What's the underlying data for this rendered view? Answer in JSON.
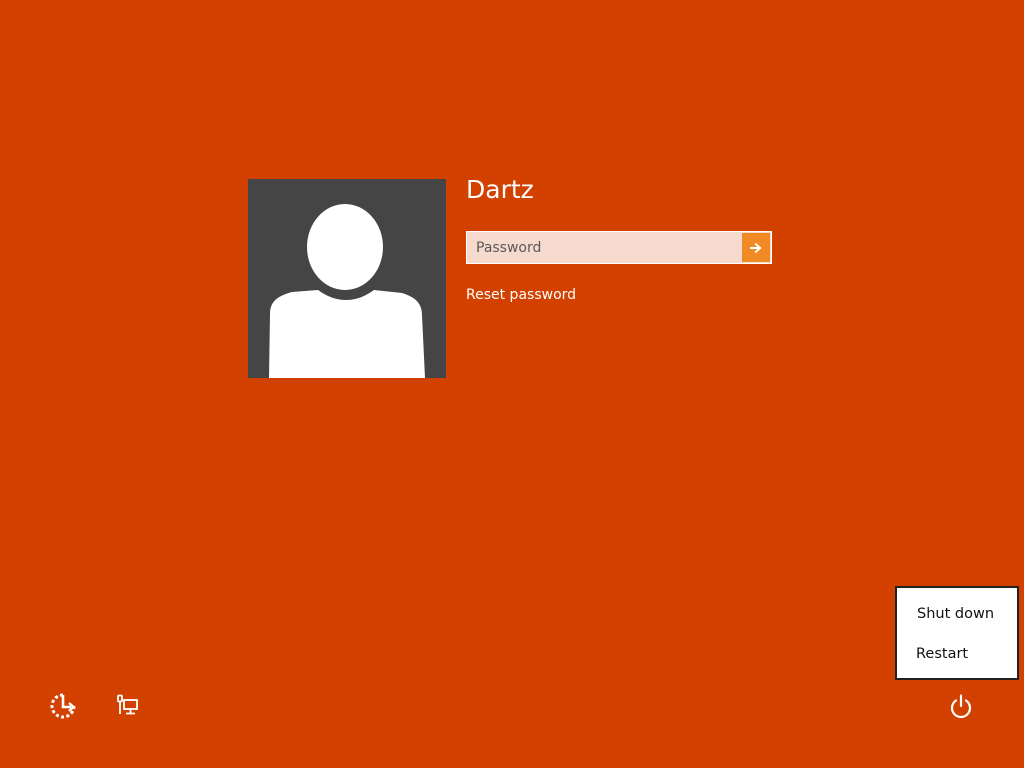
{
  "colors": {
    "background": "#D24100",
    "avatar_bg": "#454545",
    "password_field_bg": "#F6DACE",
    "submit_button": "#F08A24",
    "menu_bg": "#FFFFFF"
  },
  "user": {
    "name": "Dartz",
    "avatar_icon": "default-user-silhouette-icon"
  },
  "password": {
    "placeholder": "Password",
    "value": "",
    "submit_icon": "arrow-right-icon"
  },
  "reset_link": "Reset password",
  "power_menu": {
    "items": [
      {
        "label": "Shut down"
      },
      {
        "label": "Restart"
      }
    ]
  },
  "bottom_bar": {
    "ease_of_access_icon": "ease-of-access-icon",
    "network_icon": "network-icon",
    "power_icon": "power-icon"
  }
}
